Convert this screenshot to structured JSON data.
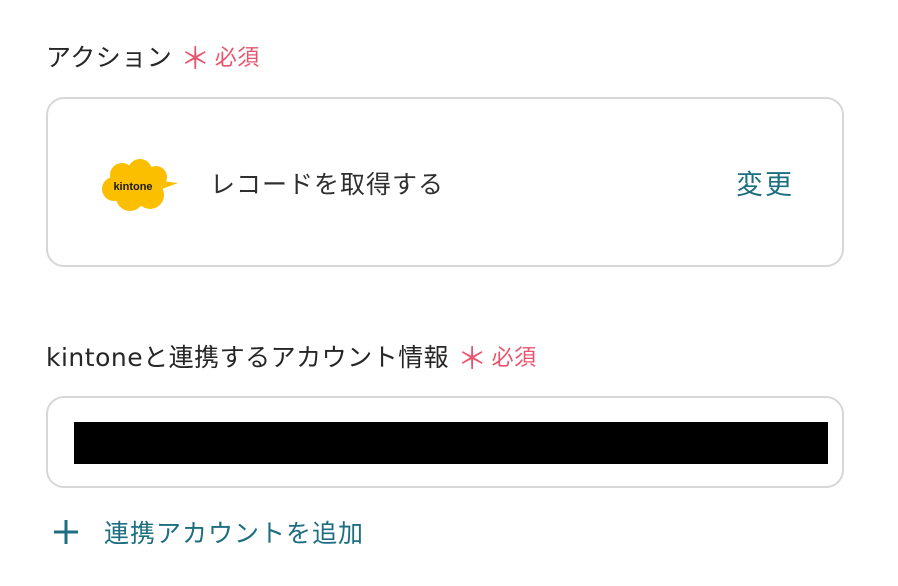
{
  "action_field": {
    "label": "アクション",
    "required_star": "＊",
    "required_text": "必須"
  },
  "action_card": {
    "app_logo_text": "kintone",
    "action_name": "レコードを取得する",
    "change_label": "変更"
  },
  "account_field": {
    "label": "kintoneと連携するアカウント情報",
    "required_star": "＊",
    "required_text": "必須"
  },
  "add_account": {
    "label": "連携アカウントを追加"
  },
  "colors": {
    "required": "#e8546c",
    "accent_teal": "#1c6e80",
    "kintone_yellow": "#fbbf00",
    "border": "#d7d7d7"
  },
  "icons": {
    "add": "plus-icon",
    "app": "kintone-logo"
  }
}
